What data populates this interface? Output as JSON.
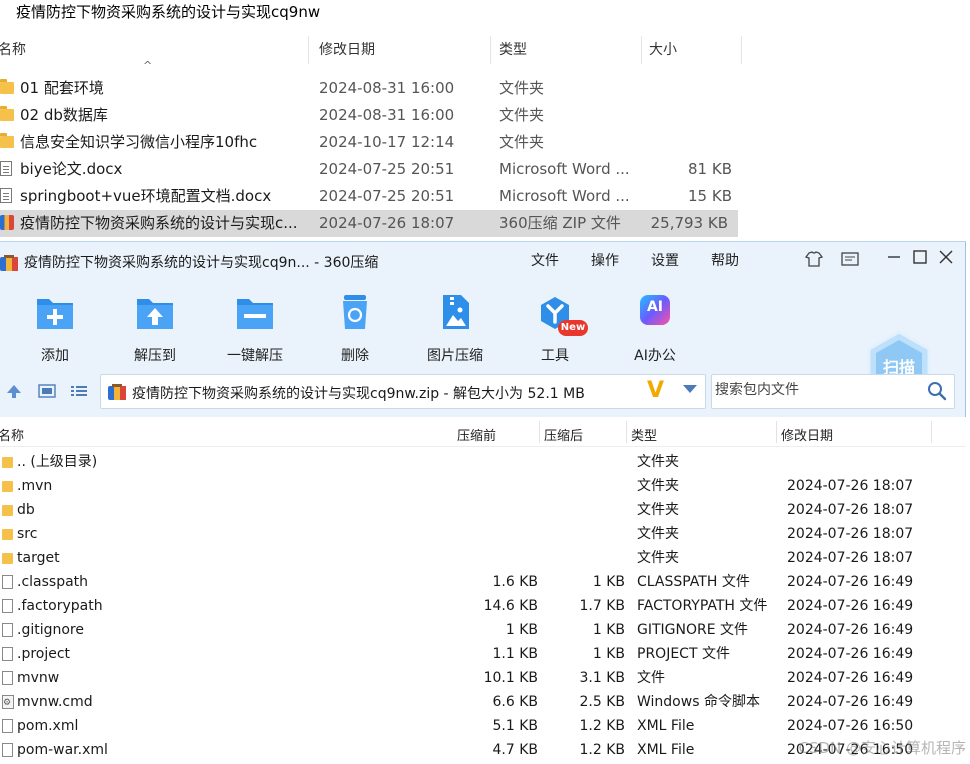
{
  "explorer": {
    "title": "疫情防控下物资采购系统的设计与实现cq9nw",
    "columns": {
      "name": "名称",
      "date": "修改日期",
      "type": "类型",
      "size": "大小"
    },
    "rows": [
      {
        "name": "01 配套环境",
        "date": "2024-08-31 16:00",
        "type": "文件夹",
        "size": "",
        "icon": "folder-icon"
      },
      {
        "name": "02 db数据库",
        "date": "2024-08-31 16:00",
        "type": "文件夹",
        "size": "",
        "icon": "folder-icon"
      },
      {
        "name": "信息安全知识学习微信小程序10fhc",
        "date": "2024-10-17 12:14",
        "type": "文件夹",
        "size": "",
        "icon": "folder-icon"
      },
      {
        "name": "biye论文.docx",
        "date": "2024-07-25 20:51",
        "type": "Microsoft Word ...",
        "size": "81 KB",
        "icon": "document-icon"
      },
      {
        "name": "springboot+vue环境配置文档.docx",
        "date": "2024-07-25 20:51",
        "type": "Microsoft Word ...",
        "size": "15 KB",
        "icon": "document-icon"
      },
      {
        "name": "疫情防控下物资采购系统的设计与实现c...",
        "date": "2024-07-26 18:07",
        "type": "360压缩 ZIP 文件",
        "size": "25,793 KB",
        "icon": "zip-archive-icon"
      }
    ]
  },
  "zip": {
    "title": "疫情防控下物资采购系统的设计与实现cq9n... - 360压缩",
    "menu": {
      "file": "文件",
      "ops": "操作",
      "settings": "设置",
      "help": "帮助"
    },
    "toolbar": {
      "add": "添加",
      "extract_to": "解压到",
      "one_click": "一键解压",
      "delete": "删除",
      "image_compress": "图片压缩",
      "tools": "工具",
      "ai_office": "AI办公",
      "new_badge": "New",
      "ai_icon_text": "AI",
      "scan": "扫描"
    },
    "address": {
      "text": "疫情防控下物资采购系统的设计与实现cq9nw.zip - 解包大小为 52.1 MB",
      "v_badge": "V"
    },
    "search": {
      "placeholder": "搜索包内文件"
    },
    "list_header": {
      "name": "名称",
      "compressed_before": "压缩前",
      "compressed_after": "压缩后",
      "type": "类型",
      "modified": "修改日期"
    },
    "rows": [
      {
        "name": ".. (上级目录)",
        "before": "",
        "after": "",
        "type": "文件夹",
        "date": "",
        "icon": "folder-icon"
      },
      {
        "name": ".mvn",
        "before": "",
        "after": "",
        "type": "文件夹",
        "date": "2024-07-26 18:07",
        "icon": "folder-icon"
      },
      {
        "name": "db",
        "before": "",
        "after": "",
        "type": "文件夹",
        "date": "2024-07-26 18:07",
        "icon": "folder-icon"
      },
      {
        "name": "src",
        "before": "",
        "after": "",
        "type": "文件夹",
        "date": "2024-07-26 18:07",
        "icon": "folder-icon"
      },
      {
        "name": "target",
        "before": "",
        "after": "",
        "type": "文件夹",
        "date": "2024-07-26 18:07",
        "icon": "folder-icon"
      },
      {
        "name": ".classpath",
        "before": "1.6 KB",
        "after": "1 KB",
        "type": "CLASSPATH 文件",
        "date": "2024-07-26 16:49",
        "icon": "file-icon"
      },
      {
        "name": ".factorypath",
        "before": "14.6 KB",
        "after": "1.7 KB",
        "type": "FACTORYPATH 文件",
        "date": "2024-07-26 16:49",
        "icon": "file-icon"
      },
      {
        "name": ".gitignore",
        "before": "1 KB",
        "after": "1 KB",
        "type": "GITIGNORE 文件",
        "date": "2024-07-26 16:49",
        "icon": "file-icon"
      },
      {
        "name": ".project",
        "before": "1.1 KB",
        "after": "1 KB",
        "type": "PROJECT 文件",
        "date": "2024-07-26 16:49",
        "icon": "file-icon"
      },
      {
        "name": "mvnw",
        "before": "10.1 KB",
        "after": "3.1 KB",
        "type": "文件",
        "date": "2024-07-26 16:49",
        "icon": "file-icon"
      },
      {
        "name": "mvnw.cmd",
        "before": "6.6 KB",
        "after": "2.5 KB",
        "type": "Windows 命令脚本",
        "date": "2024-07-26 16:49",
        "icon": "script-icon"
      },
      {
        "name": "pom.xml",
        "before": "5.1 KB",
        "after": "1.2 KB",
        "type": "XML File",
        "date": "2024-07-26 16:50",
        "icon": "file-icon"
      },
      {
        "name": "pom-war.xml",
        "before": "4.7 KB",
        "after": "1.2 KB",
        "type": "XML File",
        "date": "2024-07-26 16:50",
        "icon": "file-icon"
      }
    ]
  },
  "watermark": "CSDN @安心计算机程序",
  "colors": {
    "toolbar_blue": "#2f8fe8",
    "window_bg": "#eaf3fb",
    "selected_row": "#d9d9d9",
    "v_badge": "#f2a900",
    "new_badge": "#e8372d"
  }
}
